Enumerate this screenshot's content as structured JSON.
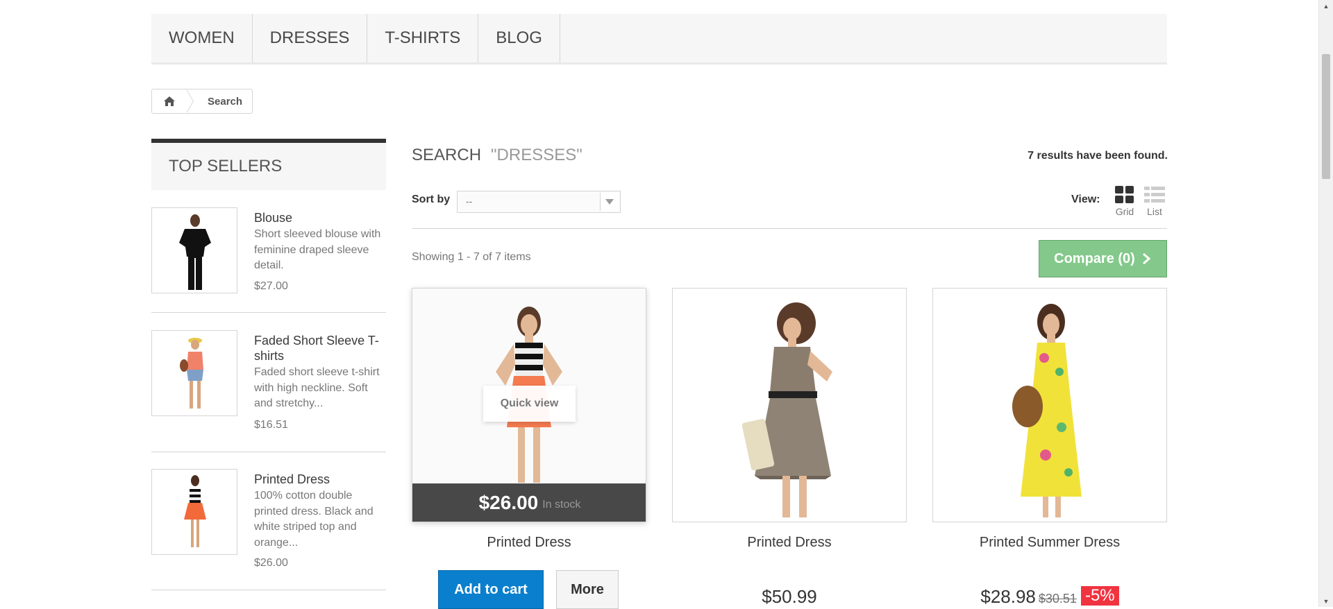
{
  "nav": {
    "items": [
      "WOMEN",
      "DRESSES",
      "T-SHIRTS",
      "BLOG"
    ]
  },
  "breadcrumb": {
    "home_icon": "home-icon",
    "current": "Search"
  },
  "sidebar": {
    "title": "TOP SELLERS",
    "items": [
      {
        "name": "Blouse",
        "description": "Short sleeved blouse with feminine draped sleeve detail.",
        "price": "$27.00"
      },
      {
        "name": "Faded Short Sleeve T-shirts",
        "description": "Faded short sleeve t-shirt with high neckline. Soft and stretchy...",
        "price": "$16.51"
      },
      {
        "name": "Printed Dress",
        "description": "100% cotton double printed dress. Black and white striped top and orange...",
        "price": "$26.00"
      }
    ]
  },
  "search": {
    "heading": "SEARCH",
    "query": "\"DRESSES\"",
    "results_text": "7 results have been found.",
    "sort_label": "Sort by",
    "sort_value": "--",
    "view_label": "View:",
    "view_grid": "Grid",
    "view_list": "List",
    "showing": "Showing 1 - 7 of 7 items",
    "compare": "Compare (0)"
  },
  "products": [
    {
      "name": "Printed Dress",
      "price": "$26.00",
      "stock": "In stock",
      "quick_view": "Quick view",
      "add_to_cart": "Add to cart",
      "more": "More"
    },
    {
      "name": "Printed Dress",
      "price": "$50.99"
    },
    {
      "name": "Printed Summer Dress",
      "price": "$28.98",
      "old_price": "$30.51",
      "discount": "-5%"
    }
  ],
  "colors": {
    "accent_blue": "#0a7fcd",
    "compare_green": "#7ec785",
    "discount_red": "#f13340",
    "dark_bar": "#484848"
  }
}
